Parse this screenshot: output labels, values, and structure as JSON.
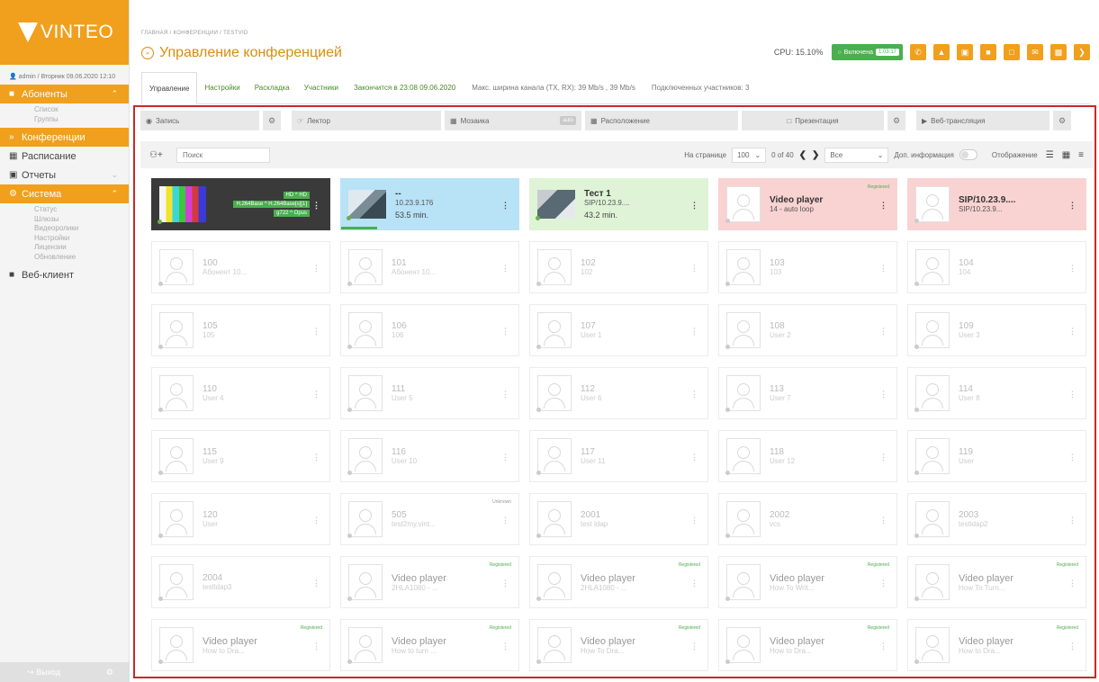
{
  "sidebar": {
    "logo": "VINTEO",
    "user_line": "admin / Вторник 09.06.2020 12:10",
    "subscribers_label": "Абоненты",
    "subscribers_items": [
      "Список",
      "Группы"
    ],
    "conferences_label": "Конференции",
    "schedule_label": "Расписание",
    "reports_label": "Отчеты",
    "system_label": "Система",
    "system_items": [
      "Статус",
      "Шлюзы",
      "Видеоролики",
      "Настройки",
      "Лицензии",
      "Обновление"
    ],
    "webclient_label": "Веб-клиент",
    "logout_label": "Выход"
  },
  "header": {
    "breadcrumb": "ГЛАВНАЯ / КОНФЕРЕНЦИИ / TESTVID",
    "title": "Управление конференцией",
    "cpu": "CPU: 15.10%",
    "status": "Включена",
    "timer": "1:03:17"
  },
  "tabs": {
    "control": "Управление",
    "settings": "Настройки",
    "layout": "Раскладка",
    "participants": "Участники",
    "ends": "Закончится в 23:08 09.06.2020",
    "bandwidth": "Макс. ширина канала (TX, RX): 39 Mb/s , 39 Mb/s",
    "connected": "Подключенных участников: 3"
  },
  "controls": {
    "record": "Запись",
    "lecturer": "Лектор",
    "mosaic": "Мозаика",
    "auto": "auto",
    "placement": "Расположение",
    "presentation": "Презентация",
    "webcast": "Веб-трансляция"
  },
  "searchbar": {
    "placeholder": "Поиск",
    "per_page_label": "На странице",
    "per_page": "100",
    "page_info": "0 of 40",
    "filter": "Все",
    "extra_info": "Доп. информация",
    "display": "Отображение"
  },
  "cards": [
    {
      "type": "dark",
      "codecs": [
        "HD ^ HD",
        "H.264Base ^ H.264Base[s][1]",
        "g722 ^ Opus"
      ]
    },
    {
      "type": "blue",
      "name": "--",
      "sub": "10.23.9.176",
      "time": "53.5 min."
    },
    {
      "type": "green",
      "name": "Тест 1",
      "sub": "SIP/10.23.9....",
      "time": "43.2 min."
    },
    {
      "type": "red",
      "name": "Video player",
      "sub": "14 - auto loop",
      "tag": "Registered"
    },
    {
      "type": "red",
      "name": "SIP/10.23.9....",
      "sub": "SIP/10.23.9..."
    },
    {
      "name": "100",
      "sub": "Абонент 10..."
    },
    {
      "name": "101",
      "sub": "Абонент 10..."
    },
    {
      "name": "102",
      "sub": "102"
    },
    {
      "name": "103",
      "sub": "103"
    },
    {
      "name": "104",
      "sub": "104"
    },
    {
      "name": "105",
      "sub": "105"
    },
    {
      "name": "106",
      "sub": "106"
    },
    {
      "name": "107",
      "sub": "User 1"
    },
    {
      "name": "108",
      "sub": "User 2"
    },
    {
      "name": "109",
      "sub": "User 3"
    },
    {
      "name": "110",
      "sub": "User 4"
    },
    {
      "name": "111",
      "sub": "User 5"
    },
    {
      "name": "112",
      "sub": "User 6"
    },
    {
      "name": "113",
      "sub": "User 7"
    },
    {
      "name": "114",
      "sub": "User 8"
    },
    {
      "name": "115",
      "sub": "User 9"
    },
    {
      "name": "116",
      "sub": "User 10"
    },
    {
      "name": "117",
      "sub": "User 11"
    },
    {
      "name": "118",
      "sub": "User 12"
    },
    {
      "name": "119",
      "sub": "User"
    },
    {
      "name": "120",
      "sub": "User"
    },
    {
      "name": "505",
      "sub": "test2my.vint...",
      "tag": "Unknown"
    },
    {
      "name": "2001",
      "sub": "test ldap"
    },
    {
      "name": "2002",
      "sub": "vcs"
    },
    {
      "name": "2003",
      "sub": "testldap2"
    },
    {
      "name": "2004",
      "sub": "testldap3"
    },
    {
      "name": "Video player",
      "sub": "2HLA1080 - ...",
      "tag": "Registered",
      "big": true
    },
    {
      "name": "Video player",
      "sub": "2HLA1080 - ...",
      "tag": "Registered",
      "big": true
    },
    {
      "name": "Video player",
      "sub": "How To Writ...",
      "tag": "Registered",
      "big": true
    },
    {
      "name": "Video player",
      "sub": "How To Turn...",
      "tag": "Registered",
      "big": true
    },
    {
      "name": "Video player",
      "sub": "How to Dra...",
      "tag": "Registered",
      "big": true
    },
    {
      "name": "Video player",
      "sub": "How to turn ...",
      "tag": "Registered",
      "big": true
    },
    {
      "name": "Video player",
      "sub": "How To Dra...",
      "tag": "Registered",
      "big": true
    },
    {
      "name": "Video player",
      "sub": "How to Dra...",
      "tag": "Registered",
      "big": true
    },
    {
      "name": "Video player",
      "sub": "How to Dra...",
      "tag": "Registered",
      "big": true
    }
  ]
}
